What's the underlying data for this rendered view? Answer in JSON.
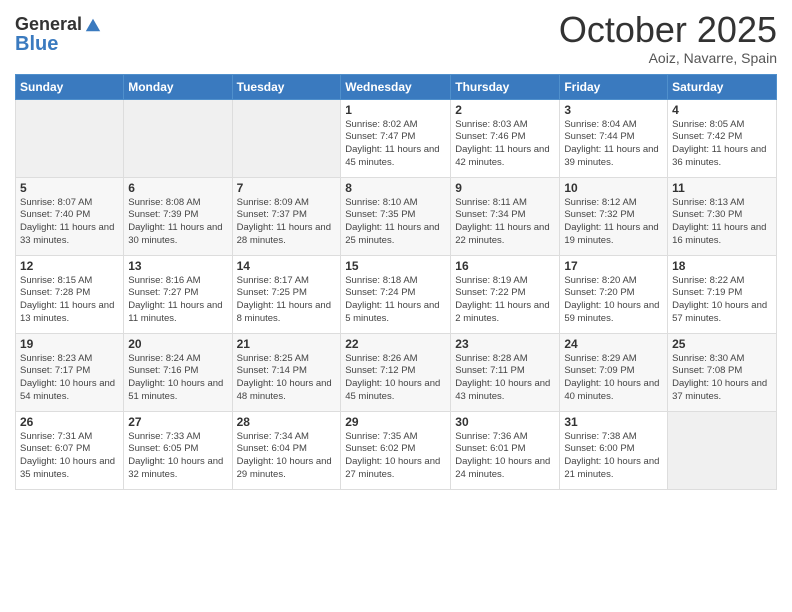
{
  "header": {
    "logo_line1": "General",
    "logo_line2": "Blue",
    "month": "October 2025",
    "location": "Aoiz, Navarre, Spain"
  },
  "days_of_week": [
    "Sunday",
    "Monday",
    "Tuesday",
    "Wednesday",
    "Thursday",
    "Friday",
    "Saturday"
  ],
  "weeks": [
    [
      {
        "day": "",
        "info": ""
      },
      {
        "day": "",
        "info": ""
      },
      {
        "day": "",
        "info": ""
      },
      {
        "day": "1",
        "info": "Sunrise: 8:02 AM\nSunset: 7:47 PM\nDaylight: 11 hours and 45 minutes."
      },
      {
        "day": "2",
        "info": "Sunrise: 8:03 AM\nSunset: 7:46 PM\nDaylight: 11 hours and 42 minutes."
      },
      {
        "day": "3",
        "info": "Sunrise: 8:04 AM\nSunset: 7:44 PM\nDaylight: 11 hours and 39 minutes."
      },
      {
        "day": "4",
        "info": "Sunrise: 8:05 AM\nSunset: 7:42 PM\nDaylight: 11 hours and 36 minutes."
      }
    ],
    [
      {
        "day": "5",
        "info": "Sunrise: 8:07 AM\nSunset: 7:40 PM\nDaylight: 11 hours and 33 minutes."
      },
      {
        "day": "6",
        "info": "Sunrise: 8:08 AM\nSunset: 7:39 PM\nDaylight: 11 hours and 30 minutes."
      },
      {
        "day": "7",
        "info": "Sunrise: 8:09 AM\nSunset: 7:37 PM\nDaylight: 11 hours and 28 minutes."
      },
      {
        "day": "8",
        "info": "Sunrise: 8:10 AM\nSunset: 7:35 PM\nDaylight: 11 hours and 25 minutes."
      },
      {
        "day": "9",
        "info": "Sunrise: 8:11 AM\nSunset: 7:34 PM\nDaylight: 11 hours and 22 minutes."
      },
      {
        "day": "10",
        "info": "Sunrise: 8:12 AM\nSunset: 7:32 PM\nDaylight: 11 hours and 19 minutes."
      },
      {
        "day": "11",
        "info": "Sunrise: 8:13 AM\nSunset: 7:30 PM\nDaylight: 11 hours and 16 minutes."
      }
    ],
    [
      {
        "day": "12",
        "info": "Sunrise: 8:15 AM\nSunset: 7:28 PM\nDaylight: 11 hours and 13 minutes."
      },
      {
        "day": "13",
        "info": "Sunrise: 8:16 AM\nSunset: 7:27 PM\nDaylight: 11 hours and 11 minutes."
      },
      {
        "day": "14",
        "info": "Sunrise: 8:17 AM\nSunset: 7:25 PM\nDaylight: 11 hours and 8 minutes."
      },
      {
        "day": "15",
        "info": "Sunrise: 8:18 AM\nSunset: 7:24 PM\nDaylight: 11 hours and 5 minutes."
      },
      {
        "day": "16",
        "info": "Sunrise: 8:19 AM\nSunset: 7:22 PM\nDaylight: 11 hours and 2 minutes."
      },
      {
        "day": "17",
        "info": "Sunrise: 8:20 AM\nSunset: 7:20 PM\nDaylight: 10 hours and 59 minutes."
      },
      {
        "day": "18",
        "info": "Sunrise: 8:22 AM\nSunset: 7:19 PM\nDaylight: 10 hours and 57 minutes."
      }
    ],
    [
      {
        "day": "19",
        "info": "Sunrise: 8:23 AM\nSunset: 7:17 PM\nDaylight: 10 hours and 54 minutes."
      },
      {
        "day": "20",
        "info": "Sunrise: 8:24 AM\nSunset: 7:16 PM\nDaylight: 10 hours and 51 minutes."
      },
      {
        "day": "21",
        "info": "Sunrise: 8:25 AM\nSunset: 7:14 PM\nDaylight: 10 hours and 48 minutes."
      },
      {
        "day": "22",
        "info": "Sunrise: 8:26 AM\nSunset: 7:12 PM\nDaylight: 10 hours and 45 minutes."
      },
      {
        "day": "23",
        "info": "Sunrise: 8:28 AM\nSunset: 7:11 PM\nDaylight: 10 hours and 43 minutes."
      },
      {
        "day": "24",
        "info": "Sunrise: 8:29 AM\nSunset: 7:09 PM\nDaylight: 10 hours and 40 minutes."
      },
      {
        "day": "25",
        "info": "Sunrise: 8:30 AM\nSunset: 7:08 PM\nDaylight: 10 hours and 37 minutes."
      }
    ],
    [
      {
        "day": "26",
        "info": "Sunrise: 7:31 AM\nSunset: 6:07 PM\nDaylight: 10 hours and 35 minutes."
      },
      {
        "day": "27",
        "info": "Sunrise: 7:33 AM\nSunset: 6:05 PM\nDaylight: 10 hours and 32 minutes."
      },
      {
        "day": "28",
        "info": "Sunrise: 7:34 AM\nSunset: 6:04 PM\nDaylight: 10 hours and 29 minutes."
      },
      {
        "day": "29",
        "info": "Sunrise: 7:35 AM\nSunset: 6:02 PM\nDaylight: 10 hours and 27 minutes."
      },
      {
        "day": "30",
        "info": "Sunrise: 7:36 AM\nSunset: 6:01 PM\nDaylight: 10 hours and 24 minutes."
      },
      {
        "day": "31",
        "info": "Sunrise: 7:38 AM\nSunset: 6:00 PM\nDaylight: 10 hours and 21 minutes."
      },
      {
        "day": "",
        "info": ""
      }
    ]
  ]
}
